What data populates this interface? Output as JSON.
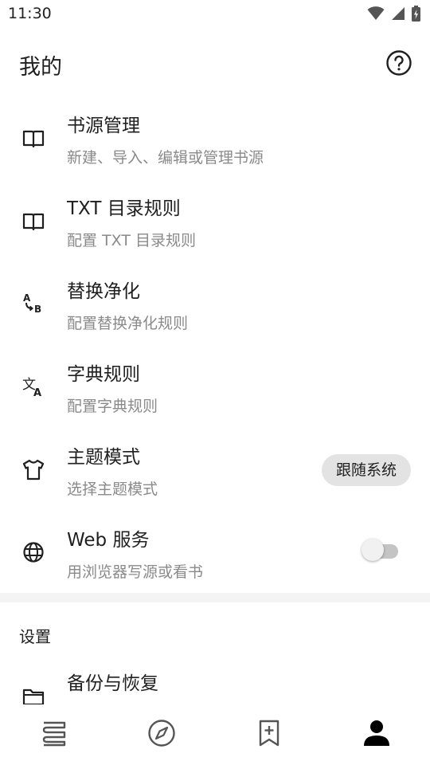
{
  "status_bar": {
    "time": "11:30"
  },
  "header": {
    "title": "我的"
  },
  "items": [
    {
      "title": "书源管理",
      "subtitle": "新建、导入、编辑或管理书源",
      "icon": "book-icon"
    },
    {
      "title": "TXT 目录规则",
      "subtitle": "配置 TXT 目录规则",
      "icon": "book-icon"
    },
    {
      "title": "替换净化",
      "subtitle": "配置替换净化规则",
      "icon": "find-replace-icon"
    },
    {
      "title": "字典规则",
      "subtitle": "配置字典规则",
      "icon": "translate-icon"
    },
    {
      "title": "主题模式",
      "subtitle": "选择主题模式",
      "icon": "shirt-icon",
      "value": "跟随系统"
    },
    {
      "title": "Web 服务",
      "subtitle": "用浏览器写源或看书",
      "icon": "globe-icon",
      "switch_on": false
    }
  ],
  "settings_section": {
    "header": "设置",
    "items": [
      {
        "title": "备份与恢复",
        "icon": "folder-icon"
      }
    ]
  },
  "bottom_nav": [
    {
      "name": "bookshelf",
      "icon": "bookshelf-icon",
      "active": false
    },
    {
      "name": "explore",
      "icon": "compass-icon",
      "active": false
    },
    {
      "name": "rss",
      "icon": "bookmark-add-icon",
      "active": false
    },
    {
      "name": "my",
      "icon": "person-icon",
      "active": true
    }
  ],
  "colors": {
    "text": "#1f1f1f",
    "secondary_text": "#8a8a8a",
    "chip_bg": "#e3e3e3",
    "active_icon": "#000000",
    "inactive_icon": "#555555"
  }
}
